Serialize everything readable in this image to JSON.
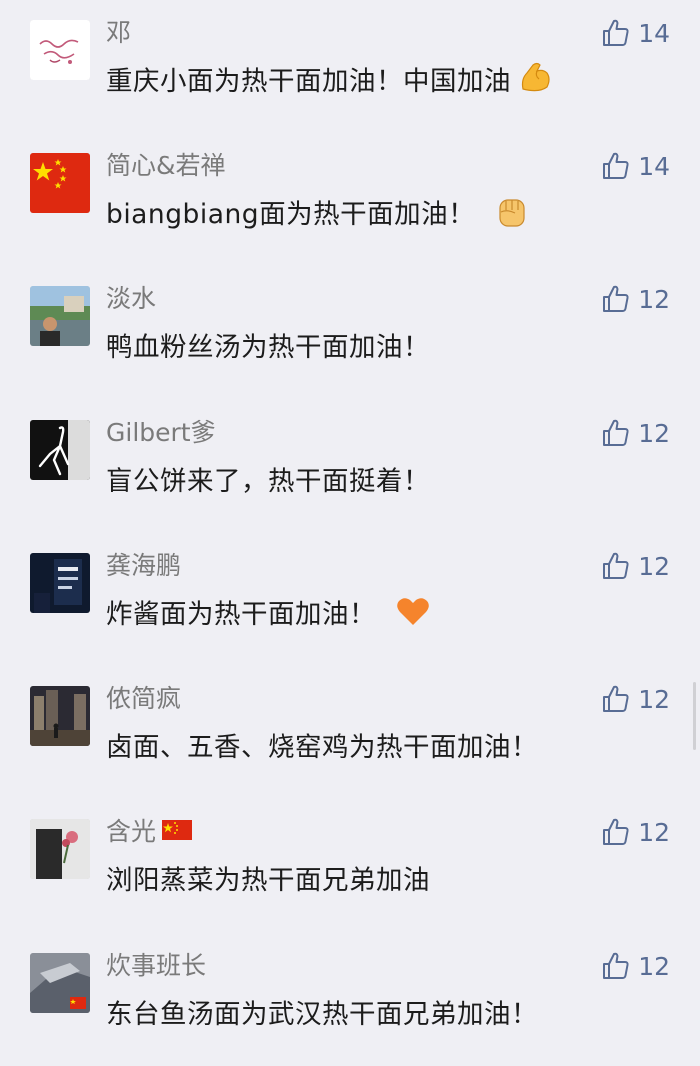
{
  "comments": [
    {
      "name": "邓",
      "text": "重庆小面为热干面加油！中国加油",
      "likes": "14"
    },
    {
      "name": "简心&若禅",
      "text": "biangbiang面为热干面加油！",
      "likes": "14"
    },
    {
      "name": "淡水",
      "text": "鸭血粉丝汤为热干面加油！",
      "likes": "12"
    },
    {
      "name": "Gilbert爹",
      "text": "盲公饼来了，热干面挺着！",
      "likes": "12"
    },
    {
      "name": "龚海鹏",
      "text": "炸酱面为热干面加油！",
      "likes": "12"
    },
    {
      "name": "侬简疯",
      "text": "卤面、五香、烧窑鸡为热干面加油！",
      "likes": "12"
    },
    {
      "name": "含光",
      "text": "浏阳蒸菜为热干面兄弟加油",
      "likes": "12"
    },
    {
      "name": "炊事班长",
      "text": "东台鱼汤面为武汉热干面兄弟加油！",
      "likes": "12"
    }
  ],
  "icons": {
    "like": "thumbs-up-outline-icon",
    "emoji_1": "flexed-biceps-emoji",
    "emoji_2": "raised-fist-emoji",
    "emoji_5": "orange-heart-emoji",
    "name_flag_7": "china-flag-emoji"
  },
  "colors": {
    "background": "#efeff4",
    "name": "#7a7a7a",
    "text": "#1c1c1c",
    "like": "#586c94"
  }
}
